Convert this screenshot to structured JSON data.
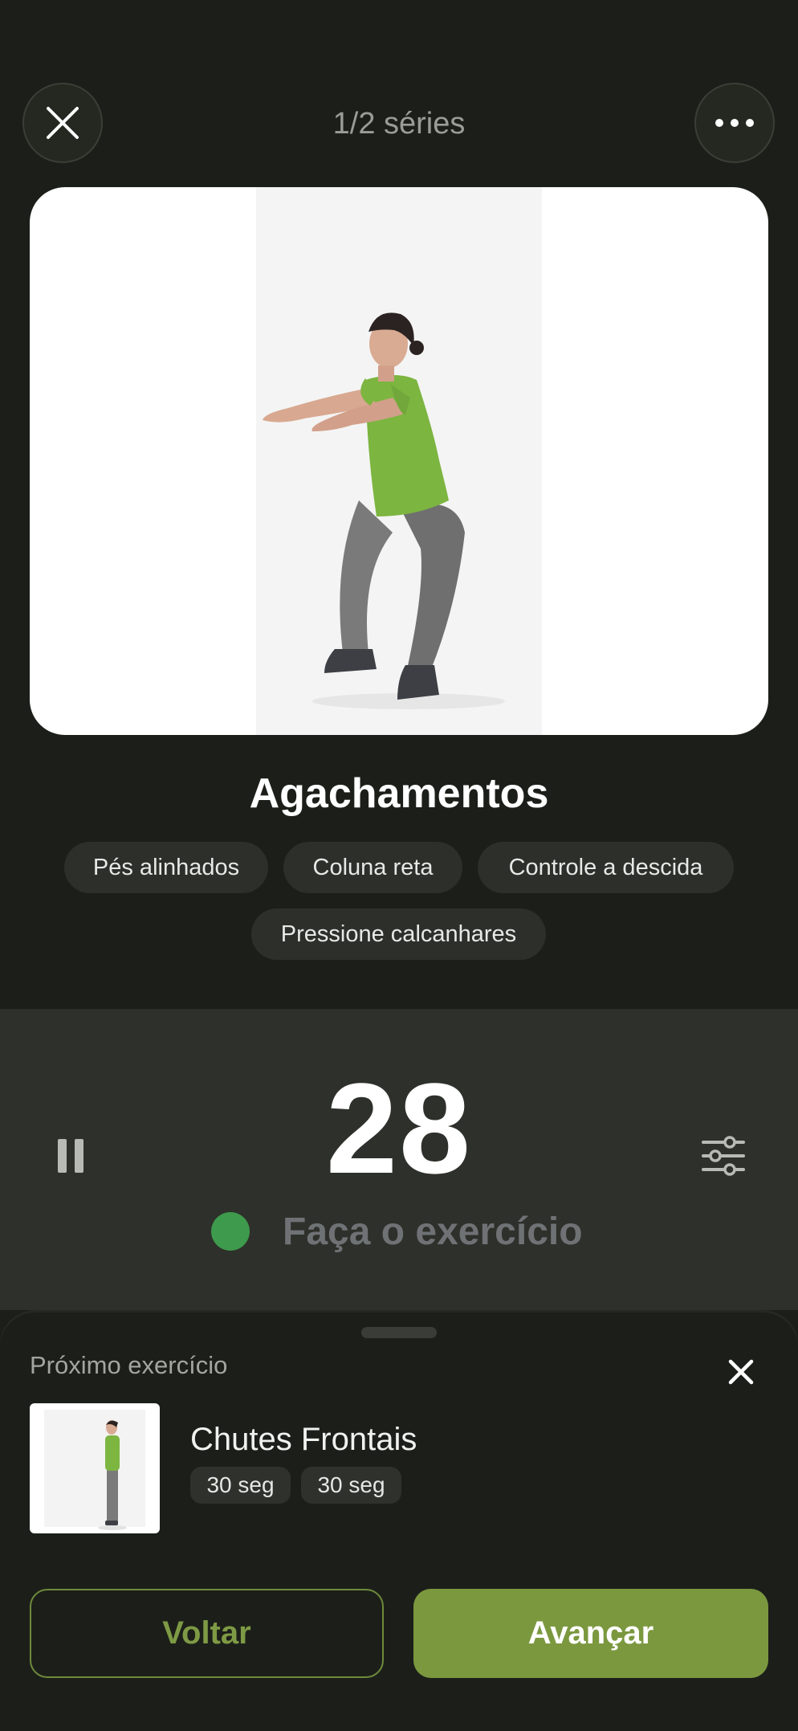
{
  "header": {
    "series_label": "1/2 séries",
    "close_icon": "close-icon",
    "more_icon": "more-dots-icon"
  },
  "exercise": {
    "title": "Agachamentos",
    "image": "woman-doing-squat-illustration",
    "tags": [
      "Pés alinhados",
      "Coluna reta",
      "Controle a descida",
      "Pressione calcanhares"
    ]
  },
  "timer": {
    "value": "28",
    "status": "Faça o exercício",
    "status_color": "#3e9a4c",
    "pause_icon": "pause-icon",
    "settings_icon": "sliders-icon"
  },
  "next": {
    "label": "Próximo exercício",
    "name": "Chutes Frontais",
    "pills": [
      "30 seg",
      "30 seg"
    ],
    "dismiss_icon": "close-icon"
  },
  "actions": {
    "back_label": "Voltar",
    "forward_label": "Avançar",
    "accent": "#7b983f"
  }
}
